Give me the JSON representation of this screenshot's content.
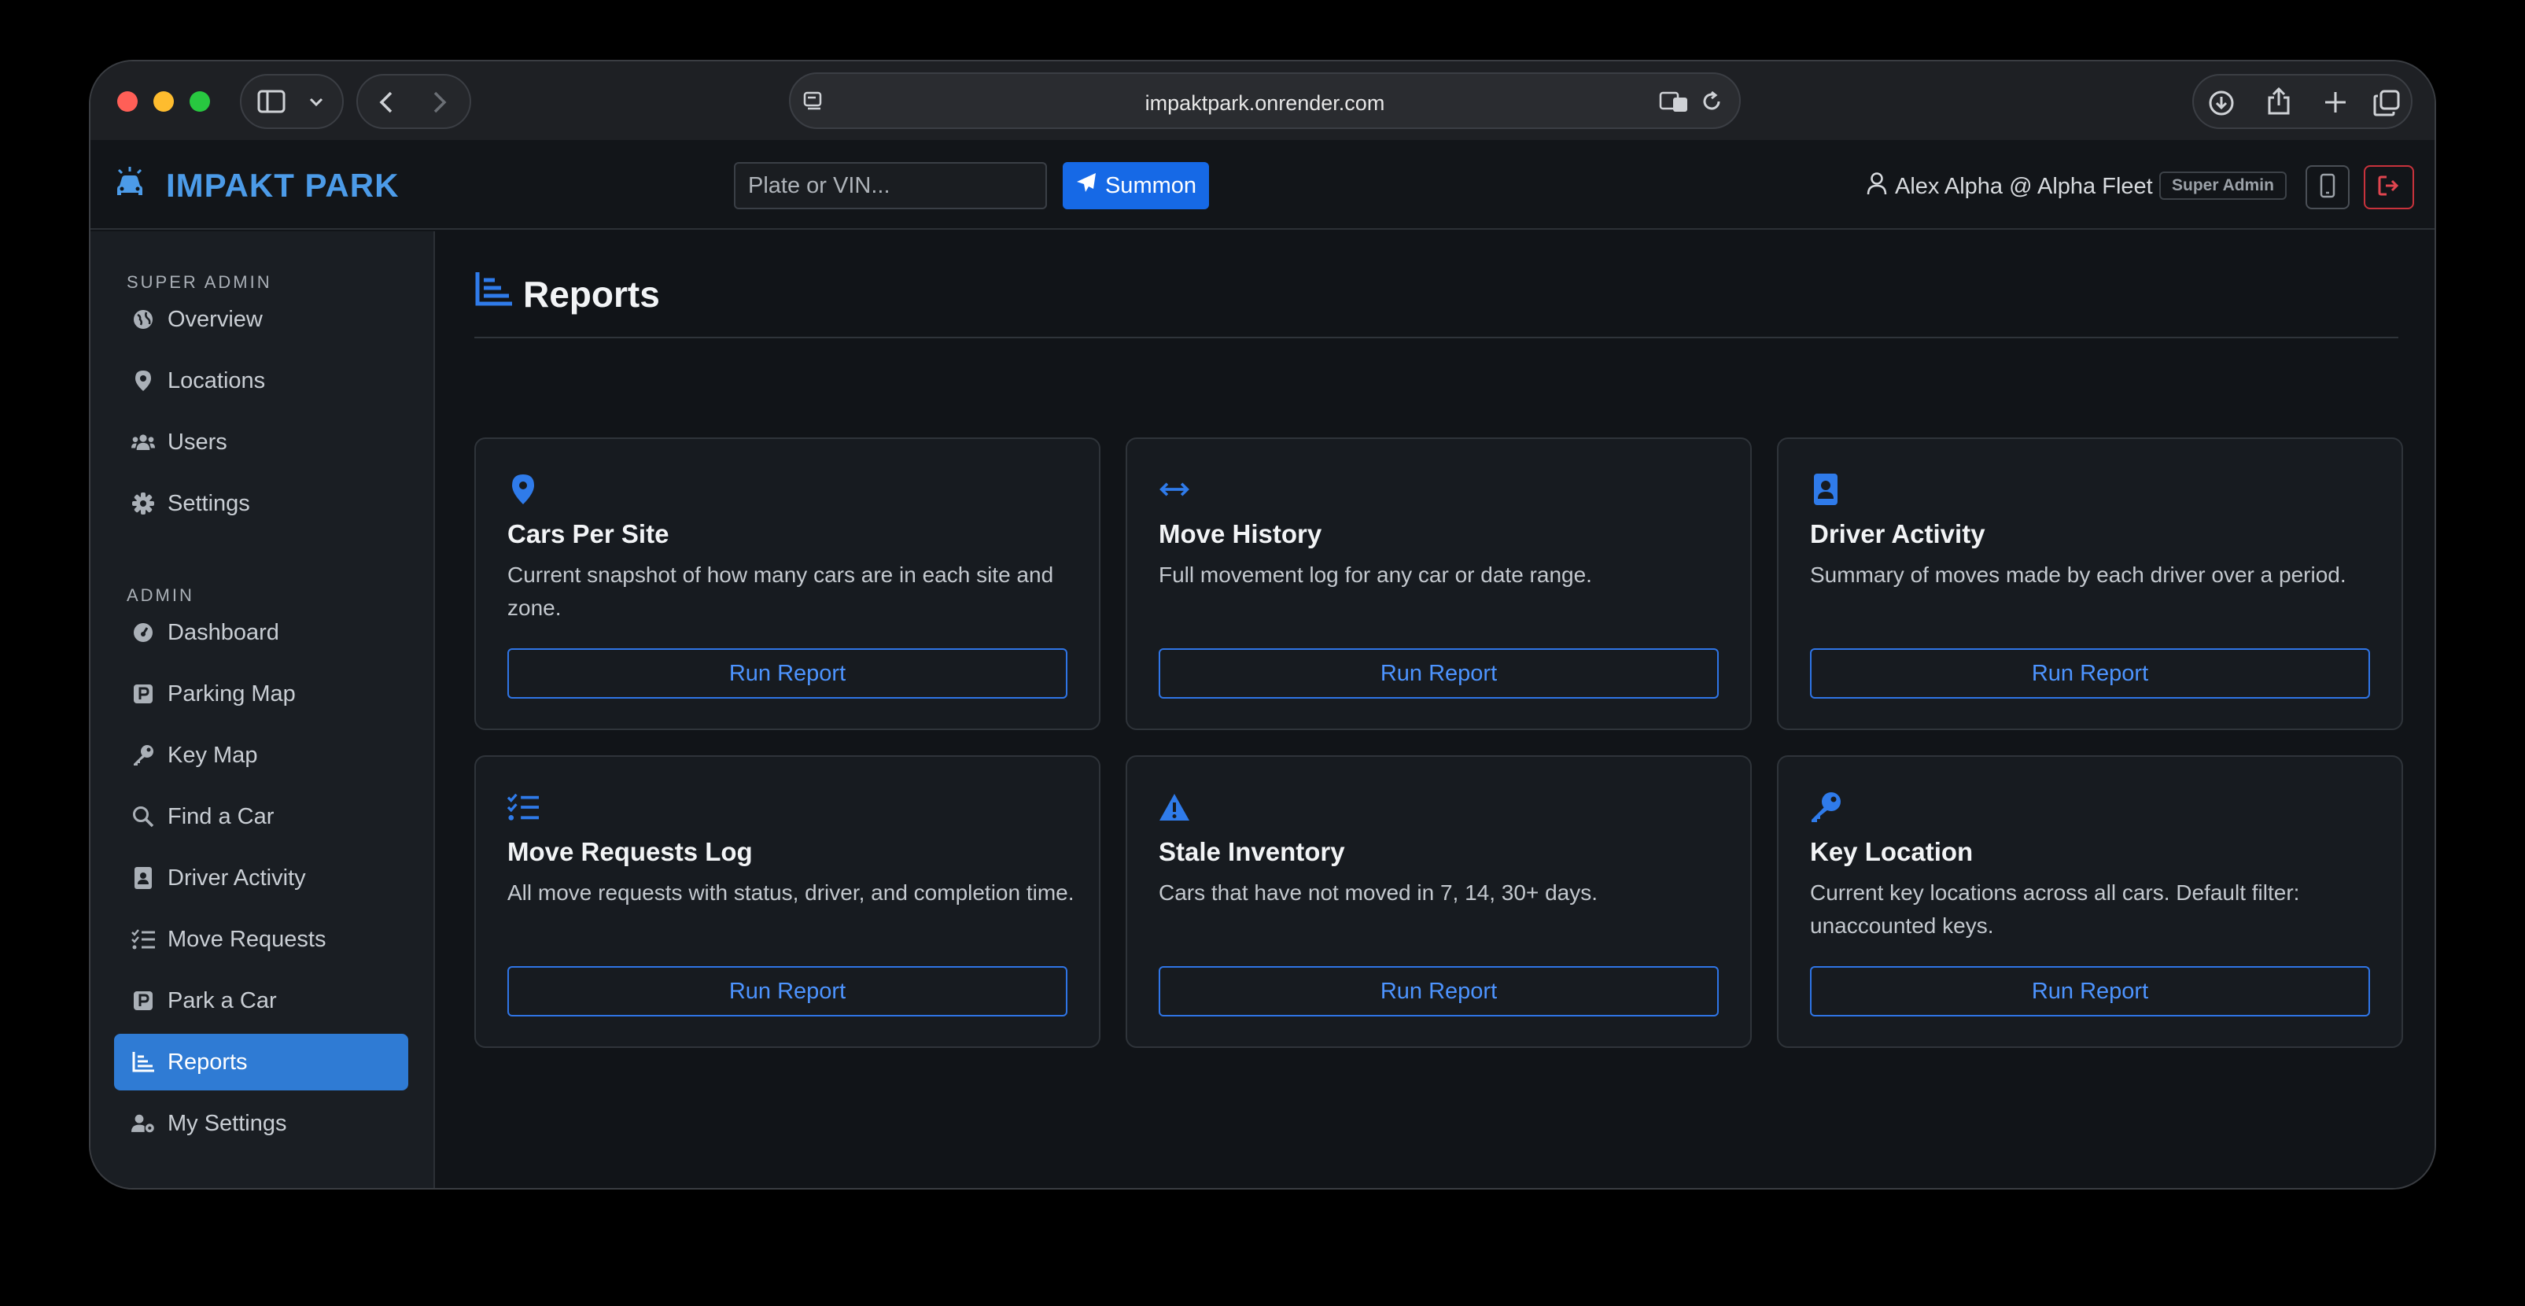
{
  "browser": {
    "url": "impaktpark.onrender.com"
  },
  "header": {
    "brand": "IMPAKT PARK",
    "search_placeholder": "Plate or VIN...",
    "summon_label": "Summon",
    "user_label": "Alex Alpha @ Alpha Fleet",
    "role_badge": "Super Admin"
  },
  "sidebar": {
    "super_admin_title": "SUPER ADMIN",
    "super_admin_items": [
      {
        "label": "Overview",
        "icon": "globe-icon"
      },
      {
        "label": "Locations",
        "icon": "map-pin-icon"
      },
      {
        "label": "Users",
        "icon": "users-icon"
      },
      {
        "label": "Settings",
        "icon": "gear-icon"
      }
    ],
    "admin_title": "ADMIN",
    "admin_items": [
      {
        "label": "Dashboard",
        "icon": "gauge-icon"
      },
      {
        "label": "Parking Map",
        "icon": "parking-icon"
      },
      {
        "label": "Key Map",
        "icon": "key-icon"
      },
      {
        "label": "Find a Car",
        "icon": "search-icon"
      },
      {
        "label": "Driver Activity",
        "icon": "id-badge-icon"
      },
      {
        "label": "Move Requests",
        "icon": "list-check-icon"
      },
      {
        "label": "Park a Car",
        "icon": "parking-icon"
      },
      {
        "label": "Reports",
        "icon": "chart-icon",
        "active": true
      },
      {
        "label": "My Settings",
        "icon": "user-gear-icon"
      }
    ]
  },
  "main": {
    "title": "Reports",
    "cards": [
      {
        "title": "Cars Per Site",
        "desc": "Current snapshot of how many cars are in each site and zone.",
        "button": "Run Report",
        "icon": "map-pin-icon"
      },
      {
        "title": "Move History",
        "desc": "Full movement log for any car or date range.",
        "button": "Run Report",
        "icon": "arrows-horizontal-icon"
      },
      {
        "title": "Driver Activity",
        "desc": "Summary of moves made by each driver over a period.",
        "button": "Run Report",
        "icon": "id-badge-icon"
      },
      {
        "title": "Move Requests Log",
        "desc": "All move requests with status, driver, and completion time.",
        "button": "Run Report",
        "icon": "list-check-icon"
      },
      {
        "title": "Stale Inventory",
        "desc": "Cars that have not moved in 7, 14, 30+ days.",
        "button": "Run Report",
        "icon": "warning-icon"
      },
      {
        "title": "Key Location",
        "desc": "Current key locations across all cars. Default filter: unaccounted keys.",
        "button": "Run Report",
        "icon": "key-icon"
      }
    ]
  },
  "colors": {
    "accent": "#1669e6",
    "brand": "#4c9be8",
    "active_nav": "#2f7bd4",
    "danger": "#c8323c"
  }
}
